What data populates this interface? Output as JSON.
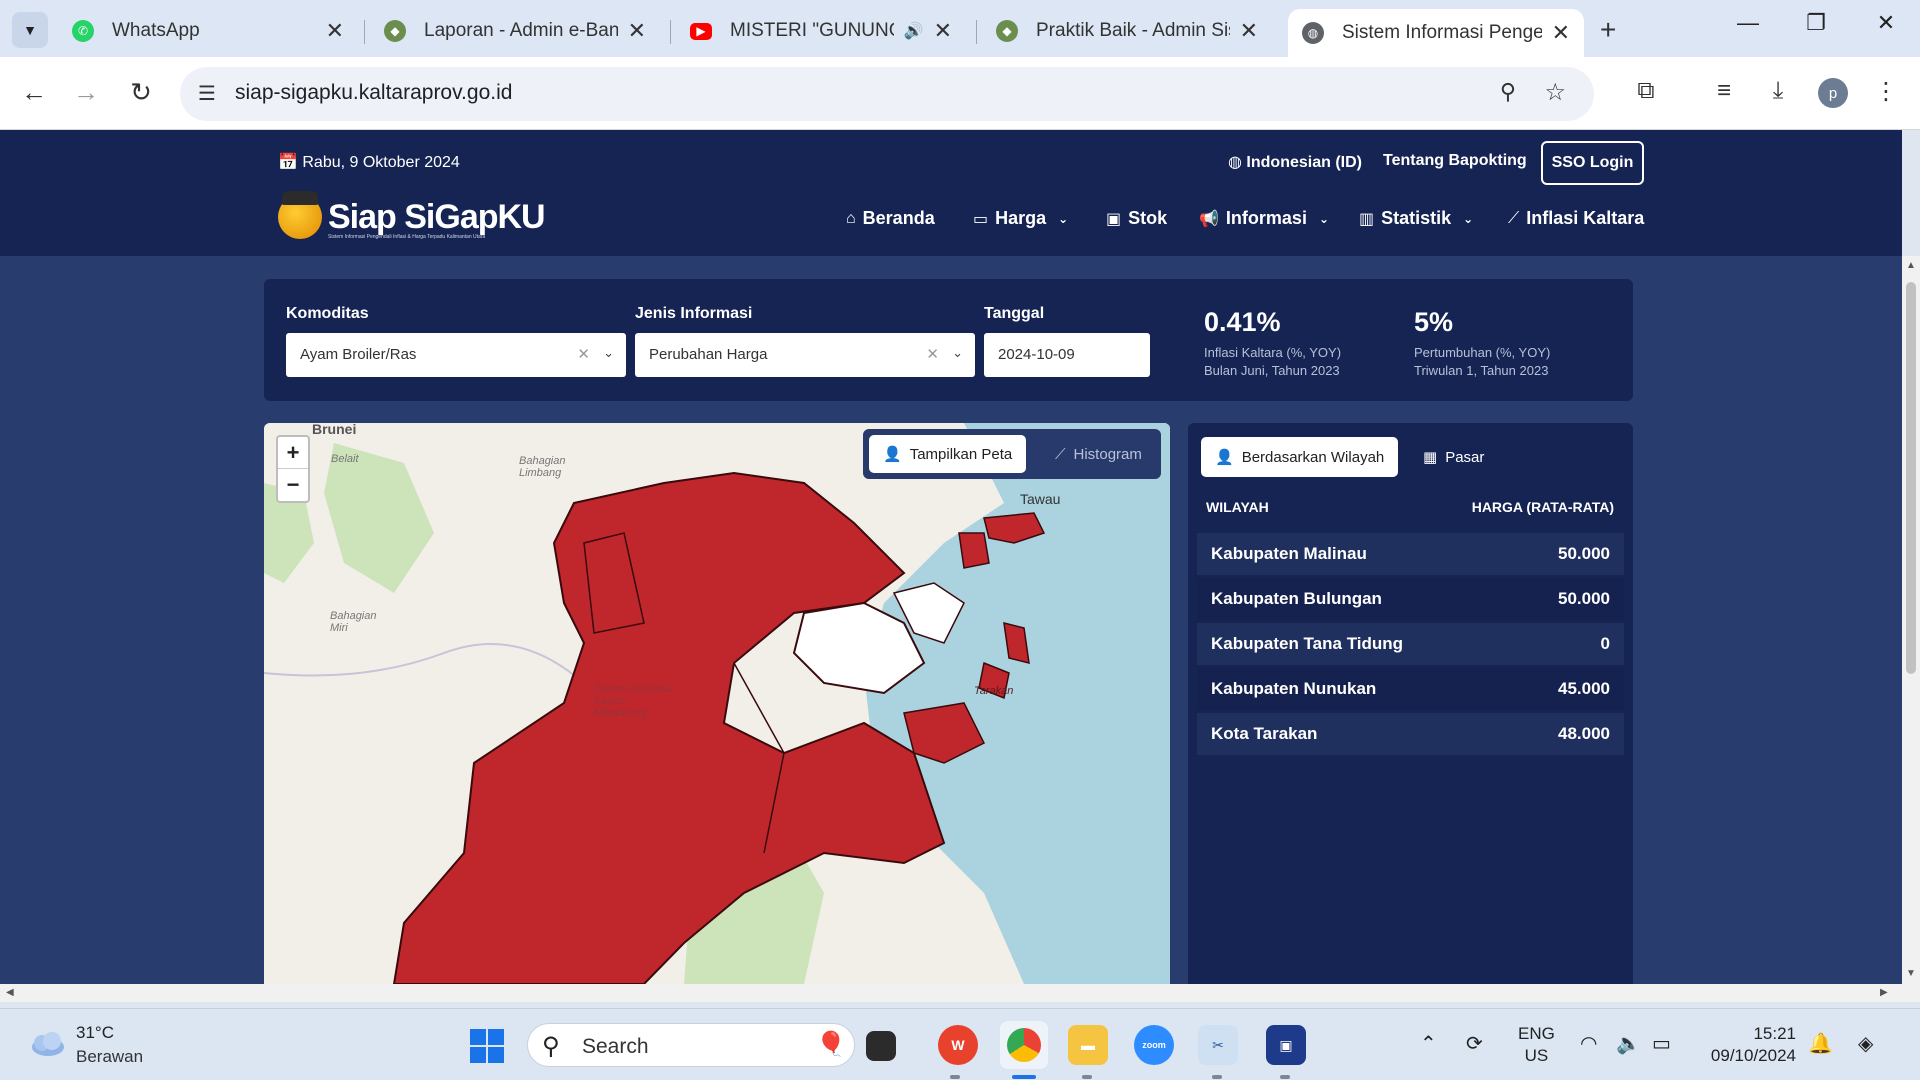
{
  "browser": {
    "tabs": [
      {
        "title": "WhatsApp"
      },
      {
        "title": "Laporan - Admin e-Bang"
      },
      {
        "title": "MISTERI \"GUNUNG P"
      },
      {
        "title": "Praktik Baik - Admin Siste"
      },
      {
        "title": "Sistem Informasi Pengen"
      }
    ],
    "url": "siap-sigapku.kaltaraprov.go.id",
    "profile_initial": "p"
  },
  "site": {
    "date": "Rabu, 9 Oktober 2024",
    "language": "Indonesian (ID)",
    "about": "Tentang Bapokting",
    "sso": "SSO Login",
    "logo_text": "Siap SiGapKU",
    "logo_sub": "Sistem Informasi Pengendali Inflasi & Harga Terpadu Kalimantan Utara",
    "nav": [
      {
        "label": "Beranda",
        "icon": "home-icon"
      },
      {
        "label": "Harga",
        "icon": "wallet-icon"
      },
      {
        "label": "Stok",
        "icon": "box-icon"
      },
      {
        "label": "Informasi",
        "icon": "megaphone-icon"
      },
      {
        "label": "Statistik",
        "icon": "bar-chart-icon"
      },
      {
        "label": "Inflasi Kaltara",
        "icon": "line-chart-icon"
      }
    ]
  },
  "filters": {
    "komoditas_label": "Komoditas",
    "komoditas_value": "Ayam Broiler/Ras",
    "jenis_label": "Jenis Informasi",
    "jenis_value": "Perubahan Harga",
    "tanggal_label": "Tanggal",
    "tanggal_value": "2024-10-09"
  },
  "stats": [
    {
      "value": "0.41%",
      "line1": "Inflasi Kaltara (%, YOY)",
      "line2": "Bulan Juni, Tahun 2023"
    },
    {
      "value": "5%",
      "line1": "Pertumbuhan (%, YOY)",
      "line2": "Triwulan 1, Tahun 2023"
    }
  ],
  "map": {
    "zoom_in": "+",
    "zoom_out": "−",
    "btn_map": "Tampilkan Peta",
    "btn_hist": "Histogram",
    "places": [
      "Brunei",
      "Belait",
      "Bahagian Limbang",
      "Bahagian Miri",
      "Tawau",
      "Tarakan",
      "Taman Nasional Kayan Mentarang"
    ],
    "region_color": "#c0272d"
  },
  "regions": {
    "tab_wilayah": "Berdasarkan Wilayah",
    "tab_pasar": "Pasar",
    "col_wilayah": "WILAYAH",
    "col_harga": "HARGA (RATA-RATA)",
    "rows": [
      {
        "name": "Kabupaten Malinau",
        "price": "50.000"
      },
      {
        "name": "Kabupaten Bulungan",
        "price": "50.000"
      },
      {
        "name": "Kabupaten Tana Tidung",
        "price": "0"
      },
      {
        "name": "Kabupaten Nunukan",
        "price": "45.000"
      },
      {
        "name": "Kota Tarakan",
        "price": "48.000"
      }
    ]
  },
  "taskbar": {
    "temp": "31°C",
    "condition": "Berawan",
    "search": "Search",
    "lang1": "ENG",
    "lang2": "US",
    "time": "15:21",
    "date": "09/10/2024"
  }
}
